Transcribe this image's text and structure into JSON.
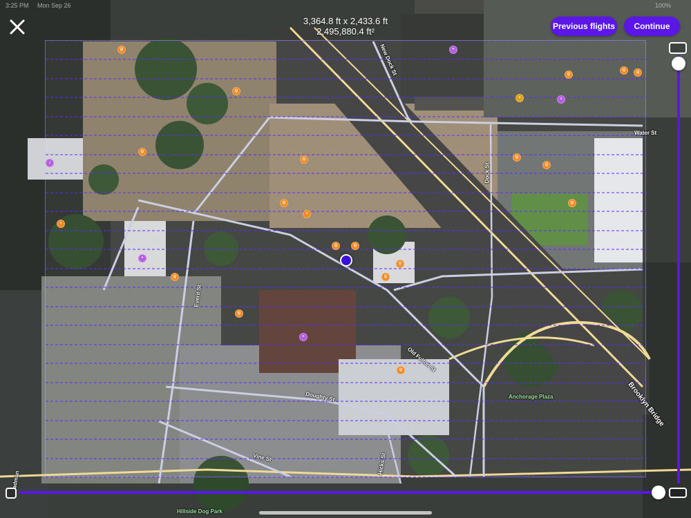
{
  "status_bar": {
    "time": "3:25 PM",
    "date": "Mon Sep 26",
    "battery": "100%"
  },
  "header": {
    "dimensions": "3,364.8 ft x 2,433.6 ft",
    "area": "2,495,880.4 ft²"
  },
  "buttons": {
    "previous_flights": "Previous flights",
    "continue": "Continue"
  },
  "map_labels": {
    "new_dock_st": "New Dock St",
    "dock_st": "Dock St",
    "water_st": "Water St",
    "everit_st": "Everit St",
    "old_fulton_st": "Old Fulton St",
    "doughty_st": "Doughty St",
    "vine_st": "Vine St",
    "hicks_st": "Hicks St",
    "anchorage_plaza": "Anchorage Plaza",
    "brooklyn_bridge": "Brooklyn Bridge",
    "hillside_dog_park": "Hillside Dog Park",
    "cadman": "adman"
  },
  "colors": {
    "accent": "#5b16e8",
    "grid_line": "#5a2bff",
    "road": "#c9cde0",
    "bridge_road": "#f0d892"
  },
  "icons": {
    "close": "close-icon",
    "location": "current-location-icon",
    "expand_horizontal": "expand-horizontal-icon",
    "shrink_horizontal": "shrink-horizontal-icon"
  }
}
